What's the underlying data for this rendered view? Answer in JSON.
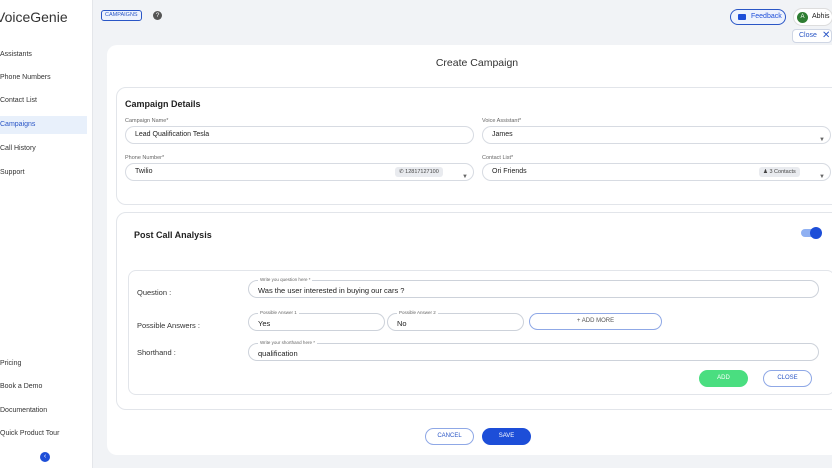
{
  "app": {
    "name": "VoiceGenie"
  },
  "sidebar": {
    "items": [
      {
        "label": "Assistants"
      },
      {
        "label": "Phone Numbers"
      },
      {
        "label": "Contact List"
      },
      {
        "label": "Campaigns"
      },
      {
        "label": "Call History"
      },
      {
        "label": "Support"
      }
    ],
    "bottom_items": [
      {
        "label": "Pricing"
      },
      {
        "label": "Book a Demo"
      },
      {
        "label": "Documentation"
      },
      {
        "label": "Quick Product Tour"
      }
    ],
    "collapse_icon": "chevron-left-icon"
  },
  "topbar": {
    "breadcrumb": "CAMPAIGNS",
    "help_icon": "?",
    "feedback_label": "Feedback",
    "user_initial": "A",
    "user_name": "Abhis",
    "close_label": "Close"
  },
  "page": {
    "title": "Create Campaign"
  },
  "campaign_details": {
    "title": "Campaign Details",
    "campaign_name_label": "Campaign Name*",
    "campaign_name_value": "Lead Qualification Tesla",
    "voice_assistant_label": "Voice Assistant*",
    "voice_assistant_value": "James",
    "phone_number_label": "Phone Number*",
    "phone_provider_value": "Twilio",
    "phone_number_badge": "12817127100",
    "contact_list_label": "Contact List*",
    "contact_list_value": "Ori Friends",
    "contacts_badge": "3 Contacts"
  },
  "post_call": {
    "title": "Post Call Analysis",
    "enabled": true,
    "question_label": "Question :",
    "question_hint": "Write you question here *",
    "question_value": "Was the user interested in buying our cars ?",
    "answers_label": "Possible Answers :",
    "answer1_hint": "Possible Answer 1",
    "answer1_value": "Yes",
    "answer2_hint": "Possible Answer 2",
    "answer2_value": "No",
    "add_more_label": "+ ADD MORE",
    "shorthand_label": "Shorthand :",
    "shorthand_hint": "Write your shorthand here *",
    "shorthand_value": "qualification",
    "add_label": "ADD",
    "close_label": "CLOSE"
  },
  "footer": {
    "cancel_label": "CANCEL",
    "save_label": "SAVE"
  },
  "colors": {
    "accent": "#1d4ed8",
    "add_button": "#4ade80",
    "active_nav_bg": "#e8f0fb",
    "page_bg": "#f1f3f6"
  }
}
